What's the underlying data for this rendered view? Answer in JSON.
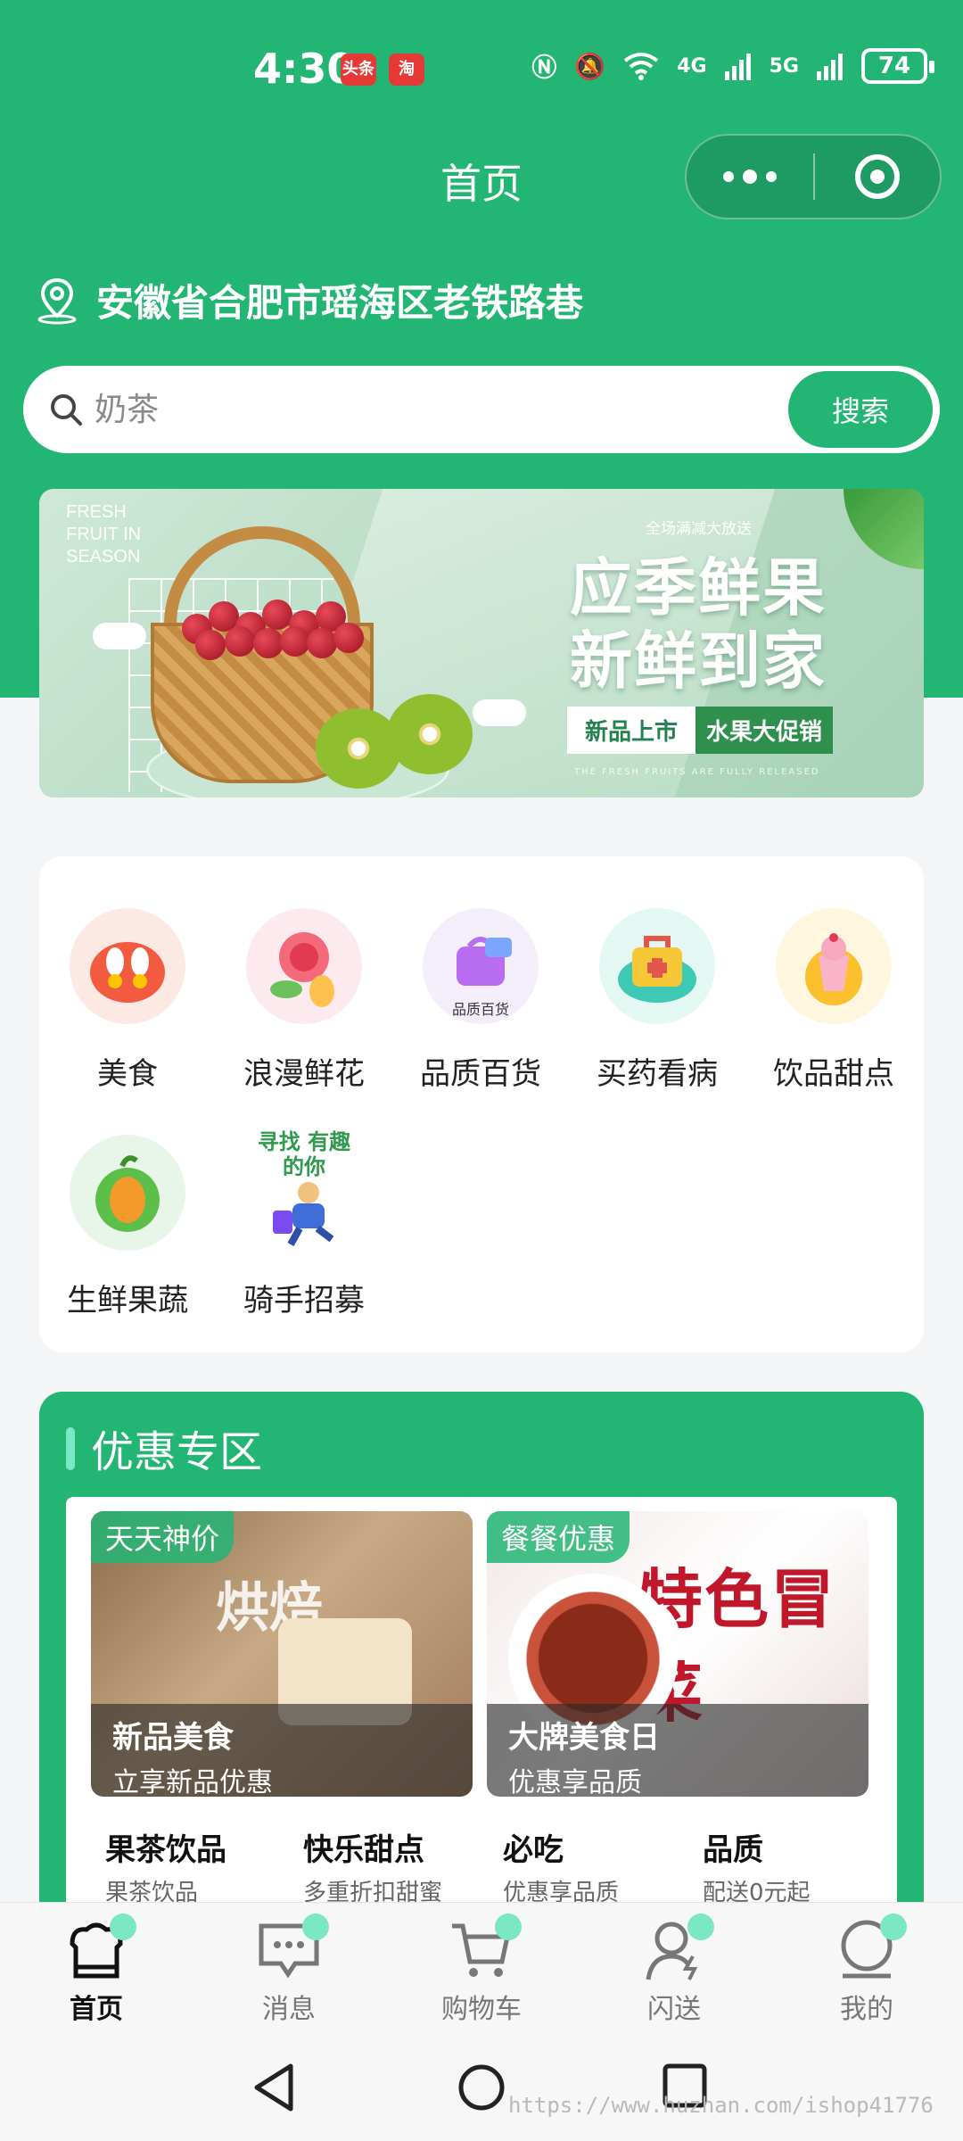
{
  "status_bar": {
    "time": "4:30",
    "app_badges": [
      "头条",
      "淘"
    ],
    "network": [
      "4G",
      "5G"
    ],
    "battery": "74"
  },
  "header": {
    "title": "首页",
    "capsule_icons": [
      "more-dots-icon",
      "target-close-icon"
    ]
  },
  "location": {
    "address": "安徽省合肥市瑶海区老铁路巷"
  },
  "search": {
    "placeholder": "奶茶",
    "button": "搜索"
  },
  "banner": {
    "tag_line1": "FRESH",
    "tag_line2": "FRUIT IN",
    "tag_line3": "SEASON",
    "top_tip": "全场满减大放送",
    "headline_line1": "应季鲜果",
    "headline_line2": "新鲜到家",
    "chip_new": "新品上市",
    "chip_promo": "水果大促销",
    "tiny_text": "THE FRESH FRUITS ARE FULLY RELEASED"
  },
  "categories": [
    {
      "label": "美食",
      "icon": "food-icon",
      "color": "#f25b3f"
    },
    {
      "label": "浪漫鲜花",
      "icon": "flower-icon",
      "color": "#f46a7a"
    },
    {
      "label": "品质百货",
      "icon": "shopping-bag-icon",
      "color": "#b86cf0",
      "caption": "品质百货"
    },
    {
      "label": "买药看病",
      "icon": "medicine-box-icon",
      "color": "#f6c737"
    },
    {
      "label": "饮品甜点",
      "icon": "dessert-cup-icon",
      "color": "#fbc02d"
    },
    {
      "label": "生鲜果蔬",
      "icon": "fruit-icon",
      "color": "#f39a2a"
    },
    {
      "label": "骑手招募",
      "icon": "rider-recruit-icon",
      "color": "#3f6ed8",
      "caption": "寻找 有趣的你"
    }
  ],
  "promo": {
    "title": "优惠专区",
    "deals": [
      {
        "badge": "天天神价",
        "title": "新品美食",
        "subtitle": "立享新品优惠"
      },
      {
        "badge": "餐餐优惠",
        "title": "大牌美食日",
        "subtitle": "优惠享品质",
        "art_text": "特色冒菜"
      }
    ],
    "subs": [
      {
        "title": "果茶饮品",
        "subtitle": "果茶饮品"
      },
      {
        "title": "快乐甜点",
        "subtitle": "多重折扣甜蜜"
      },
      {
        "title": "必吃",
        "subtitle": "优惠享品质"
      },
      {
        "title": "品质",
        "subtitle": "配送0元起"
      }
    ]
  },
  "tabbar": [
    {
      "label": "首页",
      "icon": "home-icon",
      "active": true
    },
    {
      "label": "消息",
      "icon": "message-icon",
      "active": false
    },
    {
      "label": "购物车",
      "icon": "cart-icon",
      "active": false
    },
    {
      "label": "闪送",
      "icon": "flash-delivery-icon",
      "active": false
    },
    {
      "label": "我的",
      "icon": "profile-icon",
      "active": false
    }
  ],
  "watermark": "https://www.huzhan.com/ishop41776",
  "colors": {
    "brand": "#23b574",
    "accent": "#7be8c5",
    "background": "#f4f5f6"
  }
}
